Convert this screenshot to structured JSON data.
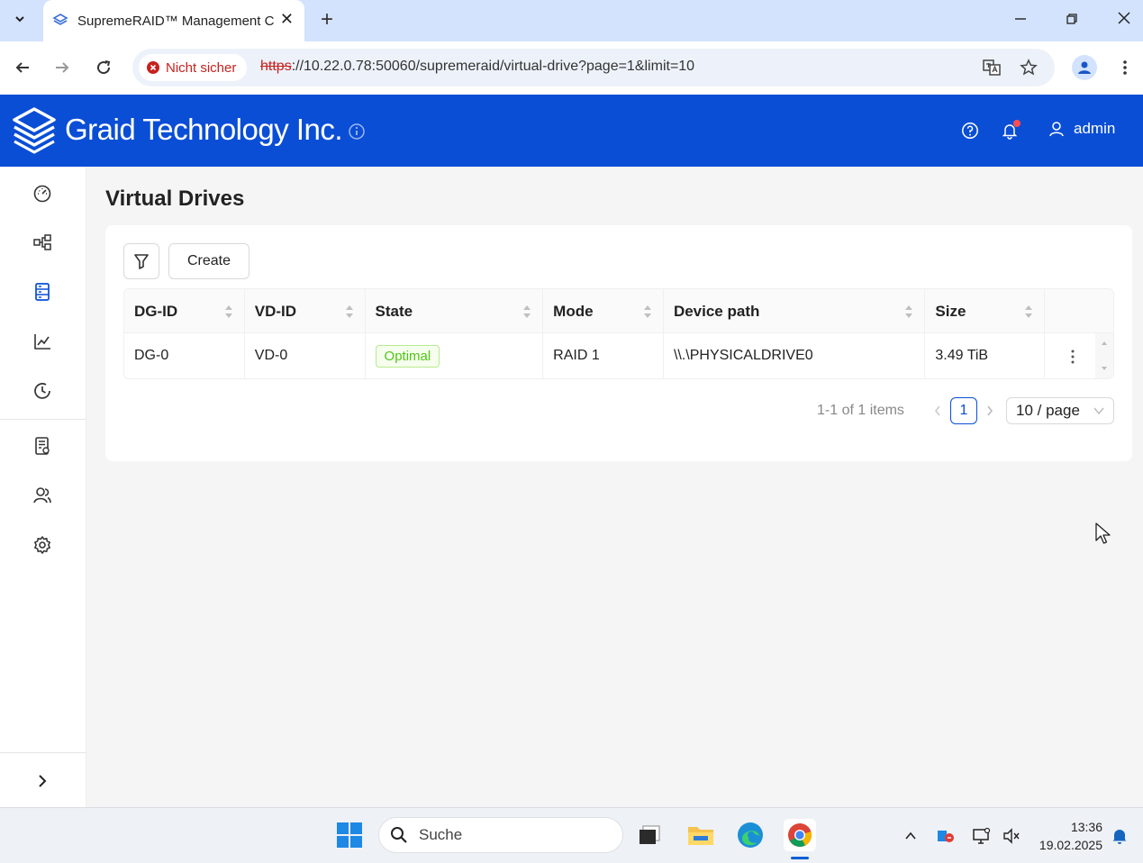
{
  "browser": {
    "tab_title": "SupremeRAID™ Management C",
    "security_label": "Nicht sicher",
    "url_scheme": "https",
    "url_rest": "://10.22.0.78:50060/supremeraid/virtual-drive?page=1&limit=10"
  },
  "header": {
    "brand": "Graid Technology Inc.",
    "user": "admin"
  },
  "page": {
    "title": "Virtual Drives",
    "create_label": "Create"
  },
  "table": {
    "columns": [
      "DG-ID",
      "VD-ID",
      "State",
      "Mode",
      "Device path",
      "Size"
    ],
    "rows": [
      {
        "dg_id": "DG-0",
        "vd_id": "VD-0",
        "state": "Optimal",
        "mode": "RAID 1",
        "device_path": "\\\\.\\PHYSICALDRIVE0",
        "size": "3.49 TiB"
      }
    ]
  },
  "pagination": {
    "total_text": "1-1 of 1 items",
    "current_page": "1",
    "page_size": "10 / page"
  },
  "taskbar": {
    "search_placeholder": "Suche",
    "time": "13:36",
    "date": "19.02.2025"
  },
  "colors": {
    "brand_blue": "#0a4ed6",
    "success_green": "#52c41a",
    "danger_red": "#c5221f"
  }
}
